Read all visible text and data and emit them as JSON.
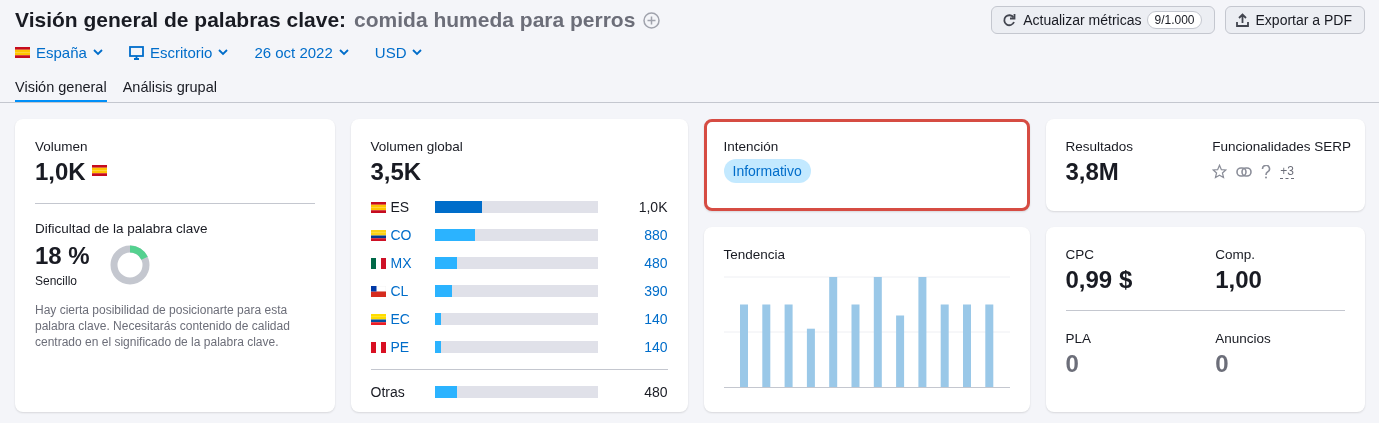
{
  "header": {
    "title": "Visión general de palabras clave:",
    "keyword": "comida humeda para perros"
  },
  "actions": [
    {
      "kind": "refresh",
      "label": "Actualizar métricas",
      "badge": "9/1.000"
    },
    {
      "kind": "export",
      "label": "Exportar a PDF"
    }
  ],
  "filters": [
    {
      "kind": "flag",
      "label": "España"
    },
    {
      "kind": "device",
      "label": "Escritorio"
    },
    {
      "kind": "plain",
      "label": "26 oct 2022"
    },
    {
      "kind": "plain",
      "label": "USD"
    }
  ],
  "tabs": [
    {
      "label": "Visión general",
      "selected": true
    },
    {
      "label": "Análisis grupal",
      "selected": false
    }
  ],
  "volume": {
    "label": "Volumen",
    "value": "1,0K"
  },
  "difficulty": {
    "label": "Dificultad de la palabra clave",
    "value": "18 %",
    "rating": "Sencillo",
    "description": "Hay cierta posibilidad de posicionarte para esta palabra clave. Necesitarás contenido de calidad centrado en el significado de la palabra clave."
  },
  "global_volume": {
    "label": "Volumen global",
    "value": "3,5K",
    "rows": [
      {
        "kind": "current",
        "code": "ES",
        "level": 0.29,
        "value": "1,0K"
      },
      {
        "kind": "link",
        "code": "CO",
        "level": 0.25,
        "value": "880"
      },
      {
        "kind": "link",
        "code": "MX",
        "level": 0.14,
        "value": "480"
      },
      {
        "kind": "link",
        "code": "CL",
        "level": 0.11,
        "value": "390"
      },
      {
        "kind": "link",
        "code": "EC",
        "level": 0.04,
        "value": "140"
      },
      {
        "kind": "link",
        "code": "PE",
        "level": 0.04,
        "value": "140"
      },
      {
        "kind": "other",
        "code": "Otras",
        "level": 0.14,
        "value": "480"
      }
    ]
  },
  "intent": {
    "label": "Intención",
    "tag": "Informativo",
    "highlighted": true
  },
  "trend": {
    "label": "Tendencia"
  },
  "results": {
    "label": "Resultados",
    "value": "3,8M"
  },
  "serp": {
    "label": "Funcionalidades SERP",
    "more": "+3"
  },
  "metrics": [
    {
      "label": "CPC",
      "value": "0,99 $",
      "muted": false
    },
    {
      "label": "Comp.",
      "value": "1,00",
      "muted": false
    },
    {
      "label": "PLA",
      "value": "0",
      "muted": true
    },
    {
      "label": "Anuncios",
      "value": "0",
      "muted": true
    }
  ]
}
